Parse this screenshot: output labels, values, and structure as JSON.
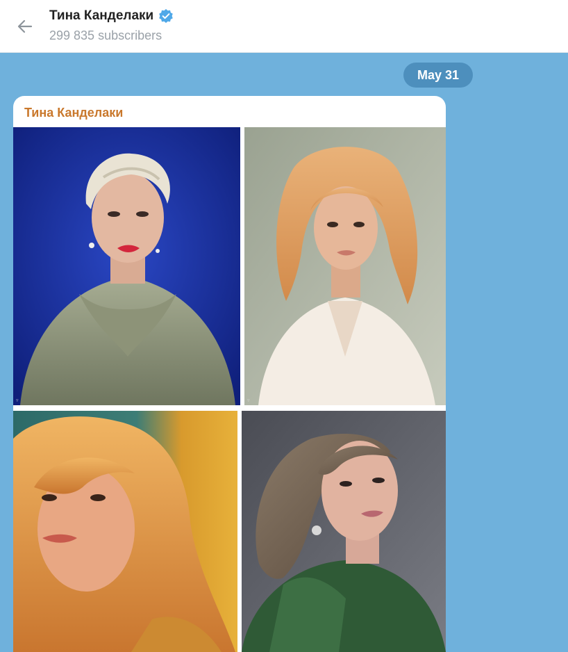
{
  "header": {
    "channel_name": "Тина Канделаки",
    "subscribers": "299 835 subscribers",
    "back_icon": "arrow-left-icon",
    "verified_icon": "verified-badge-icon",
    "verified_color": "#4fa8e8"
  },
  "chat": {
    "date_label": "May 31",
    "background_color": "#6fb1dc"
  },
  "message": {
    "sender": "Тина Канделаки",
    "sender_color": "#c9782c",
    "photos": [
      {
        "name": "photo-portrait-1"
      },
      {
        "name": "photo-portrait-2"
      },
      {
        "name": "photo-portrait-3"
      },
      {
        "name": "photo-portrait-4"
      }
    ]
  }
}
